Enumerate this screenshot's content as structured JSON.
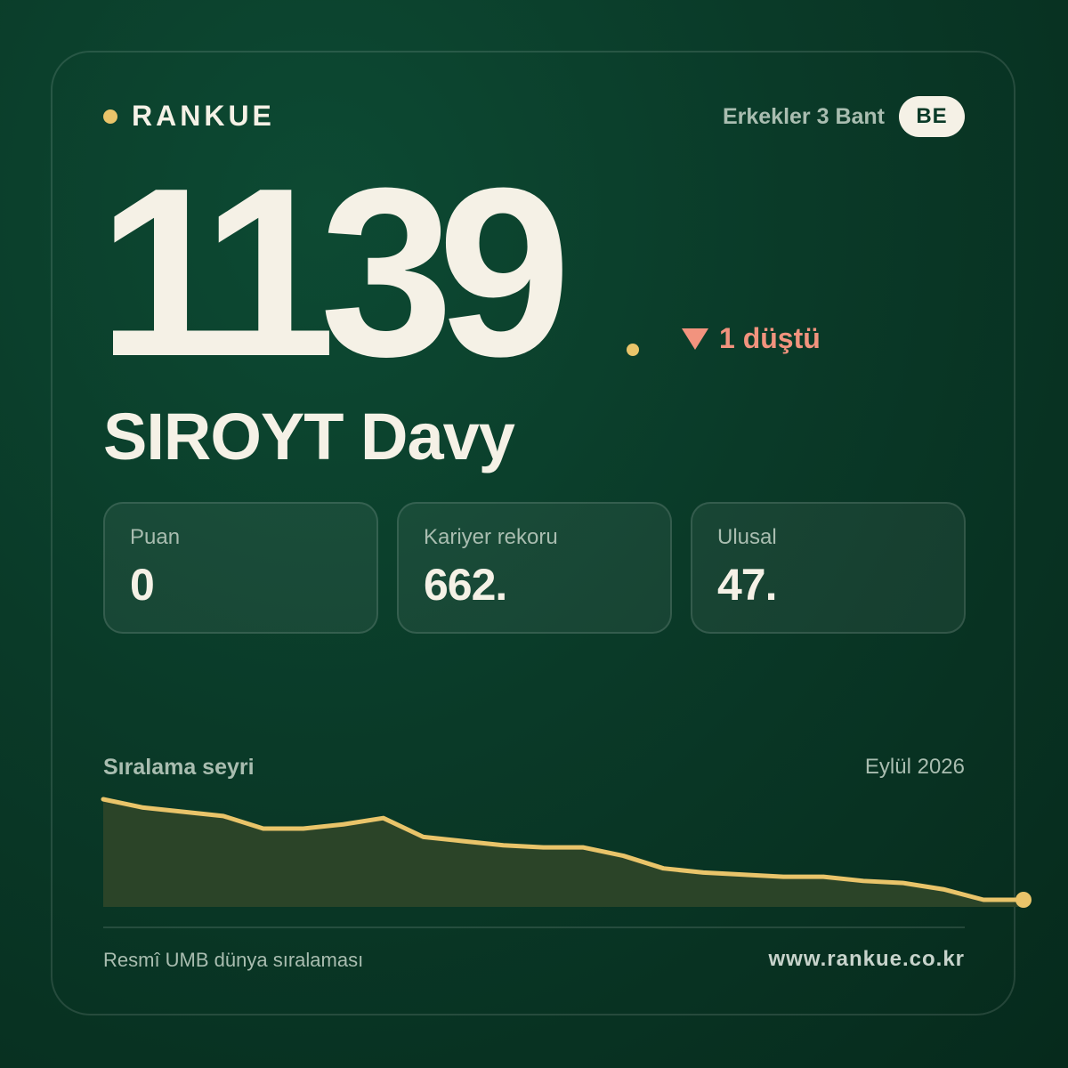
{
  "brand": {
    "name": "RANKUE"
  },
  "category": {
    "label": "Erkekler 3 Bant",
    "country": "BE"
  },
  "rank": {
    "value": "1139",
    "change_text": "1 düştü"
  },
  "player": {
    "name": "SIROYT Davy"
  },
  "stats": [
    {
      "label": "Puan",
      "value": "0"
    },
    {
      "label": "Kariyer rekoru",
      "value": "662."
    },
    {
      "label": "Ulusal",
      "value": "47."
    }
  ],
  "trend": {
    "title": "Sıralama seyri",
    "date_label": "Eylül 2026"
  },
  "chart_data": {
    "type": "area",
    "values": [
      1,
      0.96,
      0.94,
      0.92,
      0.86,
      0.86,
      0.88,
      0.91,
      0.82,
      0.8,
      0.78,
      0.77,
      0.77,
      0.73,
      0.67,
      0.65,
      0.64,
      0.63,
      0.63,
      0.61,
      0.6,
      0.57,
      0.52,
      0.52
    ],
    "grid": false,
    "line_color": "#e9c46a",
    "fill_color": "#2b4428"
  },
  "footer": {
    "source": "Resmî UMB dünya sıralaması",
    "url": "www.rankue.co.kr"
  },
  "colors": {
    "accent": "#e9c46a",
    "down": "#f2937e",
    "text": "#f5f1e6",
    "muted": "#a9bdb0"
  }
}
